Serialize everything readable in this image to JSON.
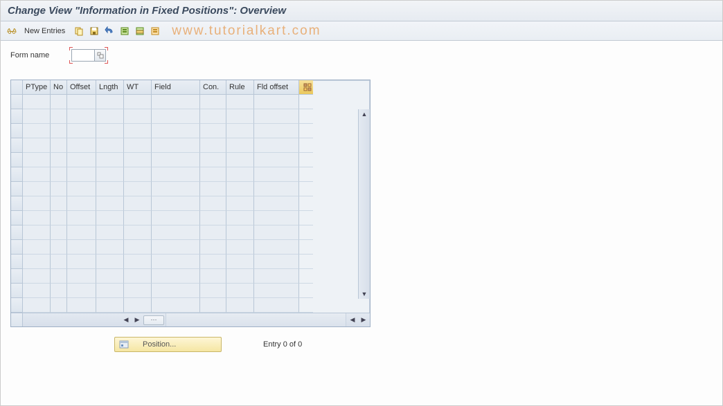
{
  "title": "Change View \"Information in Fixed Positions\": Overview",
  "toolbar": {
    "new_entries_label": "New Entries",
    "watermark": "www.tutorialkart.com",
    "icons": {
      "glasses": "glasses-icon",
      "copy": "copy-icon",
      "save": "save-icon",
      "undo": "undo-icon",
      "selectall": "select-all-icon",
      "selectblock": "select-block-icon",
      "deselect": "deselect-icon"
    }
  },
  "form": {
    "label": "Form name",
    "value": "",
    "placeholder": ""
  },
  "grid": {
    "columns": {
      "ptype": "PType",
      "no": "No",
      "offset": "Offset",
      "lngth": "Lngth",
      "wt": "WT",
      "field": "Field",
      "con": "Con.",
      "rule": "Rule",
      "fldoff": "Fld offset"
    },
    "rows": 15,
    "configure_icon": "table-config-icon"
  },
  "footer": {
    "position_label": "Position...",
    "entry_text": "Entry 0 of 0"
  }
}
